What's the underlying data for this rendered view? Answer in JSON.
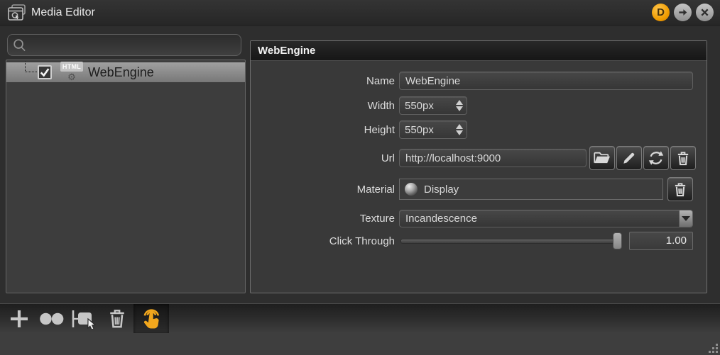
{
  "window": {
    "title": "Media Editor",
    "controls": {
      "d_label": "D"
    }
  },
  "sidebar": {
    "search": {
      "value": "",
      "placeholder": ""
    },
    "items": [
      {
        "label": "WebEngine",
        "badge": "HTML",
        "checked": true,
        "selected": true
      }
    ]
  },
  "panel": {
    "header": "WebEngine",
    "fields": {
      "name": {
        "label": "Name",
        "value": "WebEngine"
      },
      "width": {
        "label": "Width",
        "value": "550px"
      },
      "height": {
        "label": "Height",
        "value": "550px"
      },
      "url": {
        "label": "Url",
        "value": "http://localhost:9000",
        "buttons": [
          "open-folder",
          "edit-pencil",
          "refresh",
          "delete-trash"
        ]
      },
      "material": {
        "label": "Material",
        "value": "Display",
        "buttons": [
          "delete-trash"
        ]
      },
      "texture": {
        "label": "Texture",
        "value": "Incandescence"
      },
      "click_through": {
        "label": "Click Through",
        "value": "1.00",
        "slider_position": "max"
      }
    }
  },
  "toolbar": {
    "buttons": [
      {
        "icon": "plus",
        "active": false
      },
      {
        "icon": "two-circles",
        "active": false
      },
      {
        "icon": "pick-cursor",
        "active": false
      },
      {
        "icon": "trash",
        "active": false
      },
      {
        "icon": "touch-hand",
        "active": true
      }
    ]
  },
  "colors": {
    "accent_orange": "#f2a71d",
    "selected_row": "#8f8f8f",
    "panel_bg": "#393939",
    "window_bg": "#2e2e2e"
  }
}
